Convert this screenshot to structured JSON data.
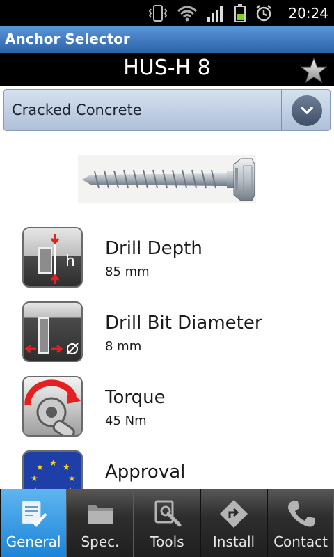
{
  "status_bar": {
    "time": "20:24",
    "icons": [
      "vibrate-icon",
      "wifi-icon",
      "signal-icon",
      "battery-icon",
      "alarm-icon"
    ]
  },
  "app_bar": {
    "title": "Anchor Selector"
  },
  "product": {
    "name": "HUS-H 8",
    "favorite_icon": "star-icon"
  },
  "selector": {
    "value": "Cracked Concrete"
  },
  "specs": [
    {
      "title": "Drill Depth",
      "value": "85 mm",
      "icon": "drill-depth-icon"
    },
    {
      "title": "Drill Bit Diameter",
      "value": "8 mm",
      "icon": "drill-bit-diameter-icon"
    },
    {
      "title": "Torque",
      "value": "45 Nm",
      "icon": "torque-icon"
    },
    {
      "title": "Approval",
      "value": "",
      "icon": "eu-approval-icon"
    }
  ],
  "tabs": [
    {
      "label": "General",
      "icon": "general-icon",
      "active": true
    },
    {
      "label": "Spec.",
      "icon": "folder-icon",
      "active": false
    },
    {
      "label": "Tools",
      "icon": "tools-icon",
      "active": false
    },
    {
      "label": "Install",
      "icon": "install-icon",
      "active": false
    },
    {
      "label": "Contact",
      "icon": "phone-icon",
      "active": false
    }
  ],
  "colors": {
    "app_bar": "#2b63a8",
    "tab_active": "#1c83d6",
    "battery": "#7ed321"
  }
}
